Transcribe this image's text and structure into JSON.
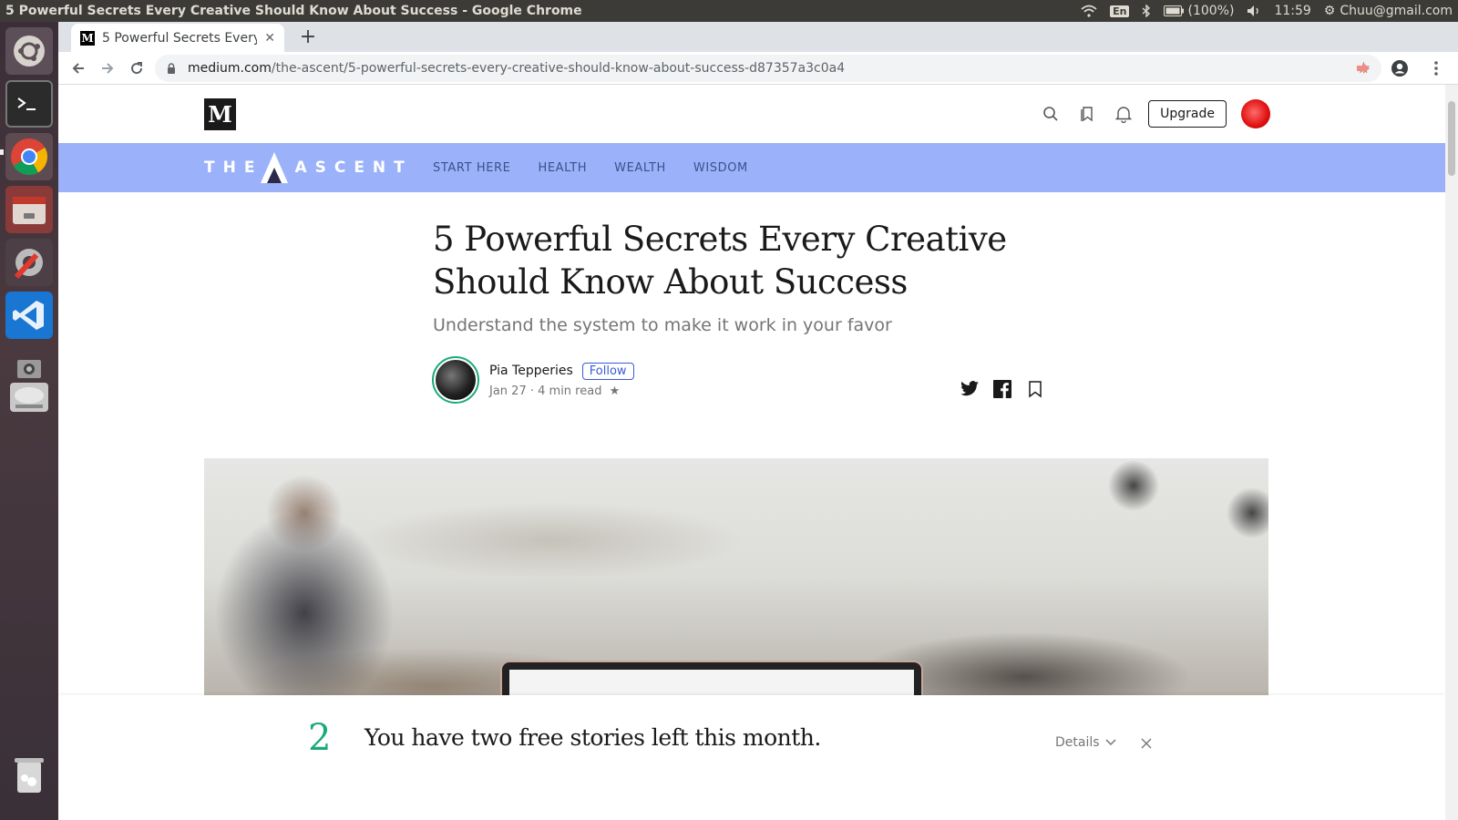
{
  "os": {
    "window_title": "5 Powerful Secrets Every Creative Should Know About Success - Google Chrome",
    "battery": "(100%)",
    "clock": "11:59",
    "user": "Chuu@gmail.com",
    "lang": "En"
  },
  "browser": {
    "tab_title": "5 Powerful Secrets Every Creative Should Know About Success",
    "url_host": "medium.com",
    "url_path": "/the-ascent/5-powerful-secrets-every-creative-should-know-about-success-d87357a3c0a4"
  },
  "site": {
    "logo_letter": "M",
    "upgrade_label": "Upgrade"
  },
  "publication": {
    "name_left": "THE",
    "name_right": "ASCENT",
    "nav": [
      "START HERE",
      "HEALTH",
      "WEALTH",
      "WISDOM"
    ],
    "color": "#9bb2fb"
  },
  "article": {
    "title_line1": "5 Powerful Secrets Every Creative",
    "title_line2": "Should Know About Success",
    "subtitle": "Understand the system to make it work in your favor",
    "author": "Pia Tepperies",
    "follow_label": "Follow",
    "date": "Jan 27",
    "read_time": "4 min read",
    "star": "★"
  },
  "paywall": {
    "count": "2",
    "message": "You have two free stories left this month.",
    "details_label": "Details"
  },
  "colors": {
    "accent_green": "#1aaa7a",
    "follow_blue": "#3a5bd6"
  }
}
